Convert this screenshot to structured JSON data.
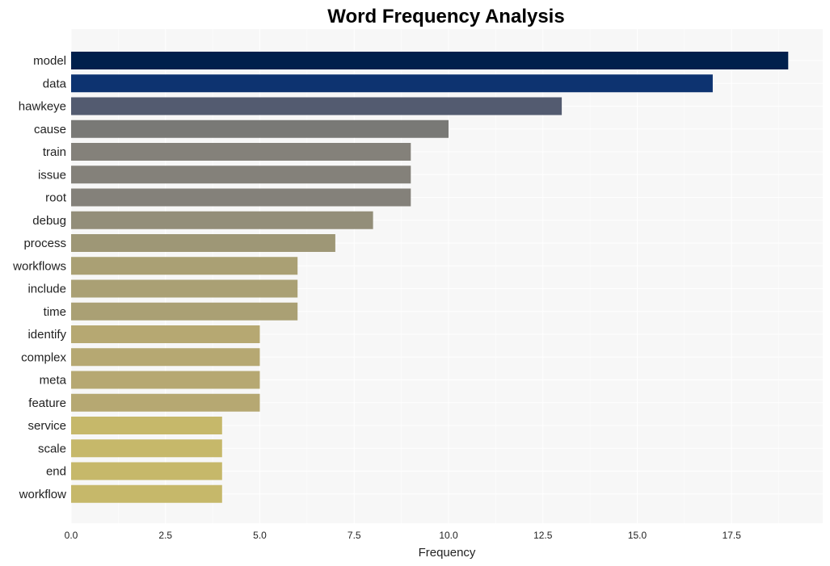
{
  "chart_data": {
    "type": "bar",
    "orientation": "horizontal",
    "title": "Word Frequency Analysis",
    "xlabel": "Frequency",
    "ylabel": "",
    "xlim": [
      0,
      19.9
    ],
    "xticks": [
      0.0,
      2.5,
      5.0,
      7.5,
      10.0,
      12.5,
      15.0,
      17.5
    ],
    "xtick_labels": [
      "0.0",
      "2.5",
      "5.0",
      "7.5",
      "10.0",
      "12.5",
      "15.0",
      "17.5"
    ],
    "grid": true,
    "categories": [
      "model",
      "data",
      "hawkeye",
      "cause",
      "train",
      "issue",
      "root",
      "debug",
      "process",
      "workflows",
      "include",
      "time",
      "identify",
      "complex",
      "meta",
      "feature",
      "service",
      "scale",
      "end",
      "workflow"
    ],
    "values": [
      19,
      17,
      13,
      10,
      9,
      9,
      9,
      8,
      7,
      6,
      6,
      6,
      5,
      5,
      5,
      5,
      4,
      4,
      4,
      4
    ],
    "colors": [
      "#00204c",
      "#0d3370",
      "#535b70",
      "#797976",
      "#84817a",
      "#84817a",
      "#84817a",
      "#938e79",
      "#9e9776",
      "#aaa074",
      "#aaa074",
      "#aaa074",
      "#b6a872",
      "#b6a872",
      "#b6a872",
      "#b6a872",
      "#c6b86a",
      "#c6b86a",
      "#c6b86a",
      "#c6b86a"
    ]
  },
  "colors": {
    "plot_background": "#f7f7f7",
    "grid": "#ffffff"
  }
}
